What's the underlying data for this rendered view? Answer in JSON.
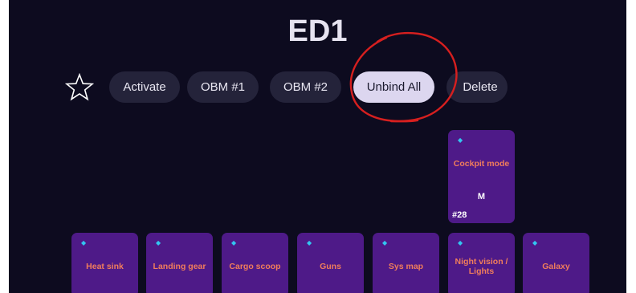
{
  "page_title": "ED1",
  "toolbar": {
    "favorite_icon": "star-outline-icon",
    "buttons": [
      {
        "label": "Activate"
      },
      {
        "label": "OBM #1"
      },
      {
        "label": "OBM #2"
      },
      {
        "label": "Unbind All",
        "active": true
      },
      {
        "label": "Delete"
      }
    ]
  },
  "keys": {
    "cockpit": {
      "label": "Cockpit mode",
      "bind": "M",
      "number": "#28"
    },
    "row": [
      {
        "label": "Heat sink"
      },
      {
        "label": "Landing gear"
      },
      {
        "label": "Cargo scoop"
      },
      {
        "label": "Guns"
      },
      {
        "label": "Sys map"
      },
      {
        "label": "Night vision / Lights"
      },
      {
        "label": "Galaxy"
      }
    ]
  },
  "colors": {
    "background": "#0d0b1f",
    "pill": "#24233a",
    "pill_active": "#dcd6ef",
    "key": "#4e1a88",
    "key_label": "#f07d5b",
    "indicator": "#33c6f0",
    "annotation": "#d61f1f"
  }
}
